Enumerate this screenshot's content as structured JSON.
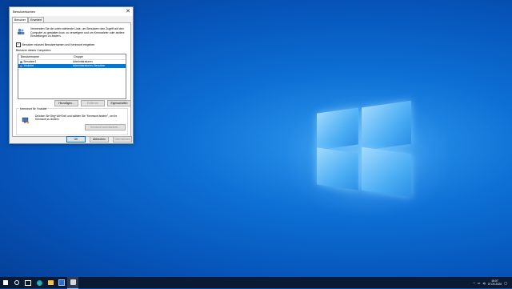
{
  "dialog": {
    "title": "Benutzerkonten",
    "close_glyph": "✕",
    "tabs": [
      {
        "label": "Benutzer",
        "active": true
      },
      {
        "label": "Erweitert",
        "active": false
      }
    ],
    "intro_text": "Verwenden Sie die unten stehende Liste, um Benutzern den Zugriff auf den Computer zu gestatten bzw. zu verweigern und um Kennwörter oder andere Einstellungen zu ändern.",
    "checkbox_label": "Benutzer müssen Benutzernamen und Kennwort eingeben",
    "checkbox_checked": true,
    "users_label": "Benutzer dieses Computers:",
    "columns": [
      "Benutzername",
      "Gruppe"
    ],
    "rows": [
      {
        "name": "Benutzer1",
        "group": "Administratoren",
        "selected": false
      },
      {
        "name": "Youtube",
        "group": "Administratoren; Benutzer",
        "selected": true
      }
    ],
    "buttons": {
      "add": "Hinzufügen...",
      "remove": "Entfernen",
      "properties": "Eigenschaften"
    },
    "password_group": {
      "legend": "Kennwort für Youtube",
      "text": "Drücken Sie Strg+Alt+Entf, und wählen Sie \"Kennwort ändern\", um Ihr Kennwort zu ändern.",
      "reset_button": "Kennwort zurücksetzen..."
    },
    "footer": {
      "ok": "OK",
      "cancel": "Abbrechen",
      "apply": "Übernehmen"
    }
  },
  "taskbar": {
    "icons": [
      "windows-start-icon",
      "search-icon",
      "task-view-icon",
      "edge-icon",
      "file-explorer-icon",
      "store-icon",
      "user-accounts-icon"
    ],
    "tray": {
      "chevron": "^",
      "time": "16:07",
      "date": "07.09.2020"
    }
  }
}
